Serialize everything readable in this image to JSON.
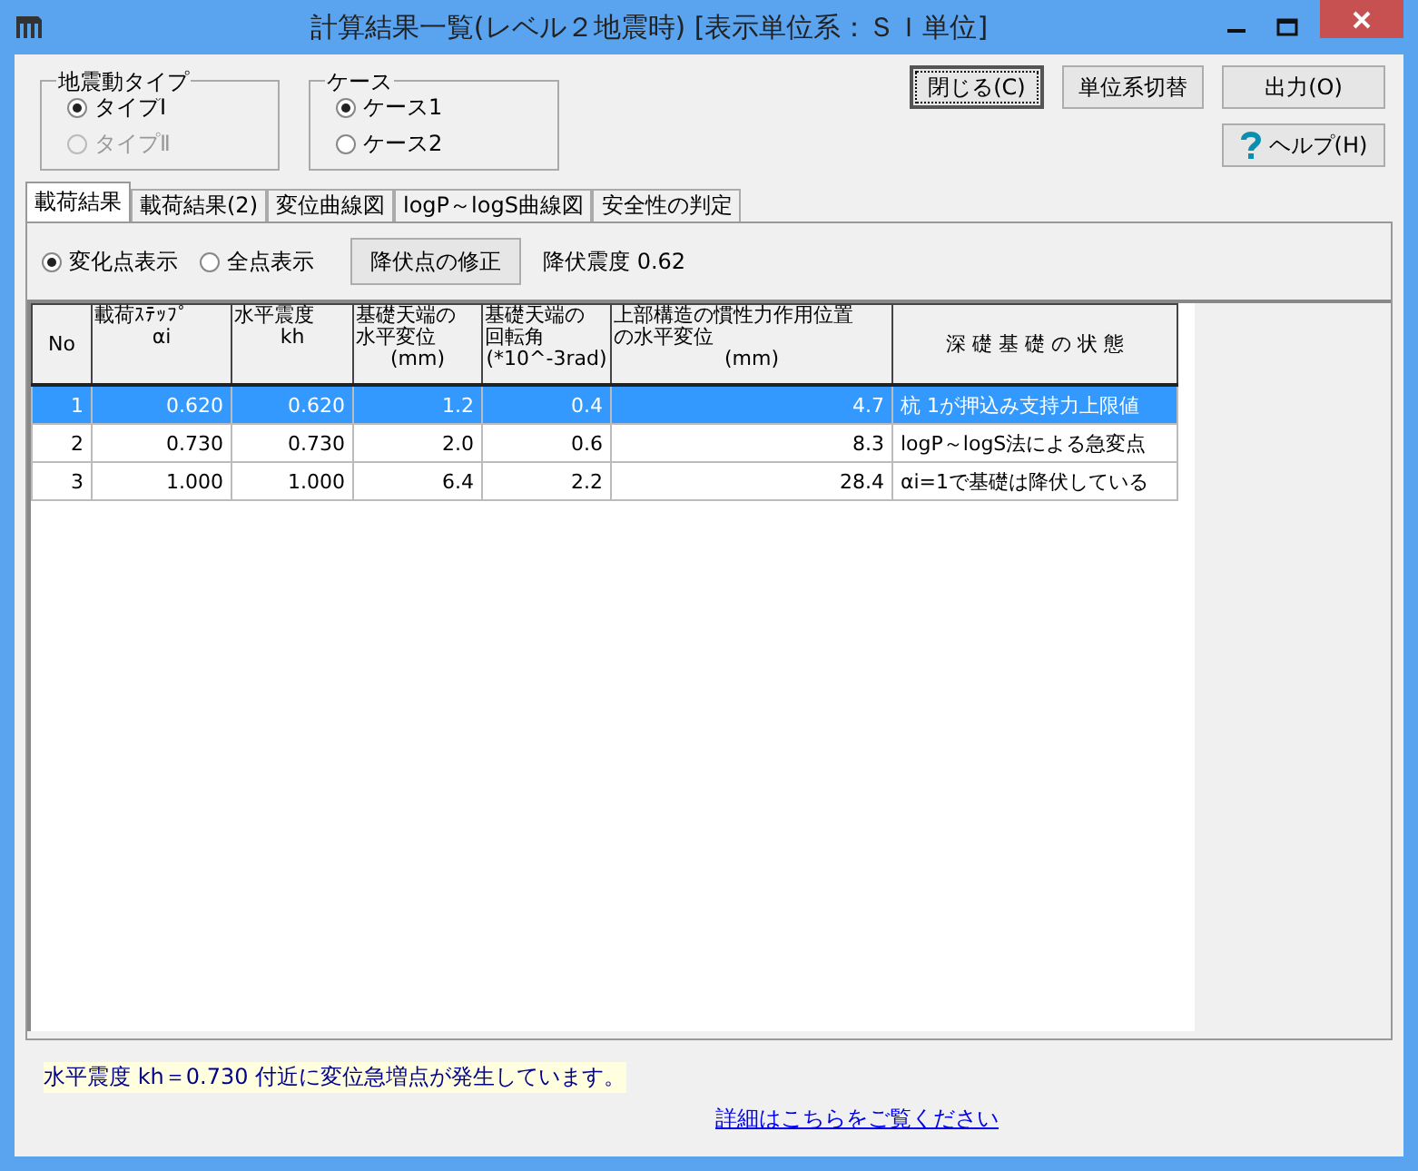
{
  "window": {
    "title": "計算結果一覧(レベル２地震時) [表示単位系：ＳＩ単位]"
  },
  "groups": [
    {
      "label": "地震動タイプ",
      "options": [
        {
          "label": "タイプⅠ",
          "selected": true,
          "disabled": false
        },
        {
          "label": "タイプⅡ",
          "selected": false,
          "disabled": true
        }
      ]
    },
    {
      "label": "ケース",
      "options": [
        {
          "label": "ケース1",
          "selected": true,
          "disabled": false
        },
        {
          "label": "ケース2",
          "selected": false,
          "disabled": false
        }
      ]
    }
  ],
  "buttons": [
    {
      "label": "閉じる(C)",
      "kind": "focused"
    },
    {
      "label": "単位系切替",
      "kind": "plain"
    },
    {
      "label": "出力(O)",
      "kind": "plain"
    },
    {
      "label": "ヘルプ(H)",
      "kind": "help"
    }
  ],
  "tabs": [
    {
      "label": "載荷結果",
      "selected": true
    },
    {
      "label": "載荷結果(2)",
      "selected": false
    },
    {
      "label": "変位曲線図",
      "selected": false
    },
    {
      "label": "logP～logS曲線図",
      "selected": false
    },
    {
      "label": "安全性の判定",
      "selected": false
    }
  ],
  "display_options": [
    {
      "label": "変化点表示",
      "selected": true
    },
    {
      "label": "全点表示",
      "selected": false
    }
  ],
  "yield_button": "降伏点の修正",
  "yield_reading": "降伏震度 0.62",
  "table": {
    "columns": [
      {
        "title": "No"
      },
      {
        "title": "載荷ｽﾃｯﾌﾟ",
        "unit": "αi"
      },
      {
        "title": "水平震度",
        "unit": "kh"
      },
      {
        "title": "基礎天端の水平変位",
        "unit": "(mm)"
      },
      {
        "title": "基礎天端の回転角",
        "unit": "(*10^-3rad)"
      },
      {
        "title": "上部構造の慣性力作用位置の水平変位",
        "unit": "(mm)"
      },
      {
        "title": "深 礎 基 礎 の 状 態"
      }
    ],
    "rows": [
      {
        "selected": true,
        "cells": [
          "1",
          "0.620",
          "0.620",
          "1.2",
          "0.4",
          "4.7",
          "杭 1が押込み支持力上限値"
        ]
      },
      {
        "selected": false,
        "cells": [
          "2",
          "0.730",
          "0.730",
          "2.0",
          "0.6",
          "8.3",
          "logP～logS法による急変点"
        ]
      },
      {
        "selected": false,
        "cells": [
          "3",
          "1.000",
          "1.000",
          "6.4",
          "2.2",
          "28.4",
          "αi=1で基礎は降伏している"
        ]
      }
    ]
  },
  "message": "水平震度 kh＝0.730 付近に変位急増点が発生しています。",
  "details_link": "詳細はこちらをご覧ください"
}
